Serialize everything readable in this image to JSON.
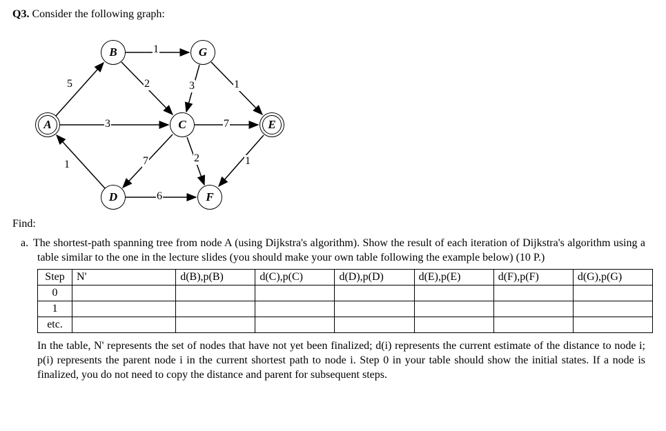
{
  "question": {
    "label": "Q3.",
    "prompt": "Consider the following graph:"
  },
  "graph": {
    "nodes": {
      "A": "A",
      "B": "B",
      "C": "C",
      "D": "D",
      "E": "E",
      "F": "F",
      "G": "G"
    },
    "edges": {
      "AB": "5",
      "AD": "1",
      "AC": "3",
      "BC": "2",
      "BG": "1",
      "GC": "3",
      "GE": "1",
      "CE": "7",
      "CF": "2",
      "DC": "7",
      "DF": "6",
      "EF": "1"
    }
  },
  "find_label": "Find:",
  "part_a": {
    "letter": "a.",
    "text": "The shortest-path spanning tree from node A (using Dijkstra's algorithm). Show the result of each iteration of Dijkstra's algorithm using a table similar to the one in the lecture slides (you should make your own table following the example below) (10 P.)"
  },
  "table": {
    "headers": {
      "step": "Step",
      "n": "N'",
      "dB": "d(B),p(B)",
      "dC": "d(C),p(C)",
      "dD": "d(D),p(D)",
      "dE": "d(E),p(E)",
      "dF": "d(F),p(F)",
      "dG": "d(G),p(G)"
    },
    "rows": [
      {
        "step": "0"
      },
      {
        "step": "1"
      },
      {
        "step": "etc."
      }
    ]
  },
  "explain": "In the table, N' represents the set of nodes that have not yet been finalized; d(i) represents the current estimate of the distance to node i; p(i) represents the parent node i in the current shortest path to node i. Step 0 in your table should show the initial states. If a node is finalized, you do not need to copy the distance and parent for subsequent steps.",
  "chart_data": {
    "type": "graph",
    "directed": true,
    "nodes": [
      "A",
      "B",
      "C",
      "D",
      "E",
      "F",
      "G"
    ],
    "edges": [
      {
        "from": "A",
        "to": "B",
        "weight": 5
      },
      {
        "from": "D",
        "to": "A",
        "weight": 1
      },
      {
        "from": "A",
        "to": "C",
        "weight": 3
      },
      {
        "from": "B",
        "to": "C",
        "weight": 2
      },
      {
        "from": "B",
        "to": "G",
        "weight": 1
      },
      {
        "from": "G",
        "to": "C",
        "weight": 3
      },
      {
        "from": "G",
        "to": "E",
        "weight": 1
      },
      {
        "from": "C",
        "to": "E",
        "weight": 7
      },
      {
        "from": "C",
        "to": "F",
        "weight": 2
      },
      {
        "from": "C",
        "to": "D",
        "weight": 7
      },
      {
        "from": "D",
        "to": "F",
        "weight": 6
      },
      {
        "from": "E",
        "to": "F",
        "weight": 1
      }
    ]
  }
}
